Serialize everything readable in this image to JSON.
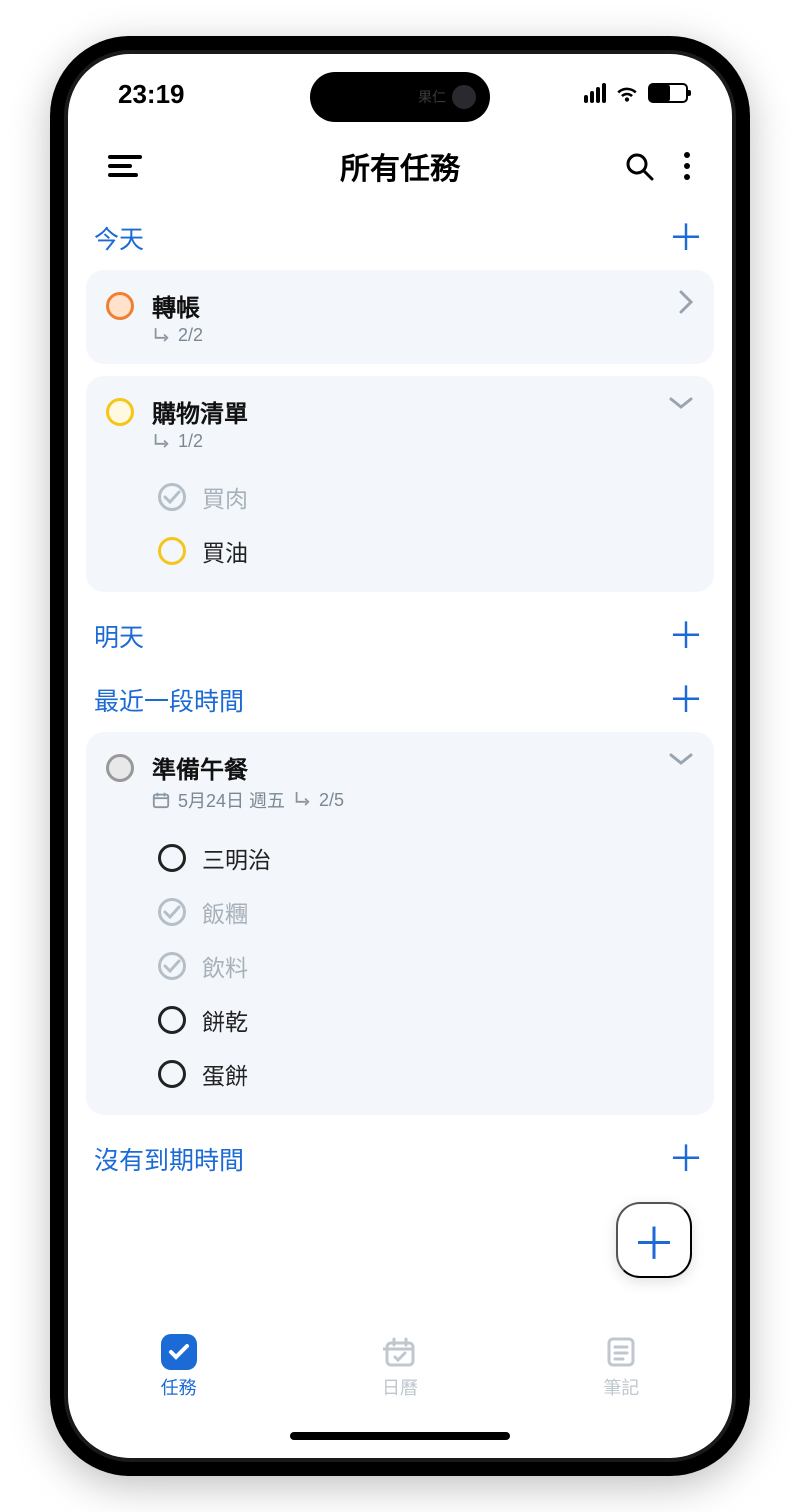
{
  "status": {
    "time": "23:19",
    "island_label": "果仁"
  },
  "header": {
    "title": "所有任務"
  },
  "sections": {
    "today": {
      "label": "今天"
    },
    "tomorrow": {
      "label": "明天"
    },
    "recent": {
      "label": "最近一段時間"
    },
    "undated": {
      "label": "沒有到期時間"
    }
  },
  "tasks": {
    "transfer": {
      "title": "轉帳",
      "progress": "2/2"
    },
    "shopping": {
      "title": "購物清單",
      "progress": "1/2",
      "subtasks": {
        "meat": {
          "label": "買肉",
          "done": true
        },
        "oil": {
          "label": "買油",
          "done": false
        }
      }
    },
    "lunch": {
      "title": "準備午餐",
      "date": "5月24日 週五",
      "progress": "2/5",
      "subtasks": {
        "sandwich": {
          "label": "三明治",
          "done": false
        },
        "riceball": {
          "label": "飯糰",
          "done": true
        },
        "drink": {
          "label": "飲料",
          "done": true
        },
        "biscuit": {
          "label": "餅乾",
          "done": false
        },
        "eggcrepe": {
          "label": "蛋餅",
          "done": false
        }
      }
    }
  },
  "tabbar": {
    "tasks": {
      "label": "任務"
    },
    "calendar": {
      "label": "日曆"
    },
    "notes": {
      "label": "筆記"
    }
  }
}
